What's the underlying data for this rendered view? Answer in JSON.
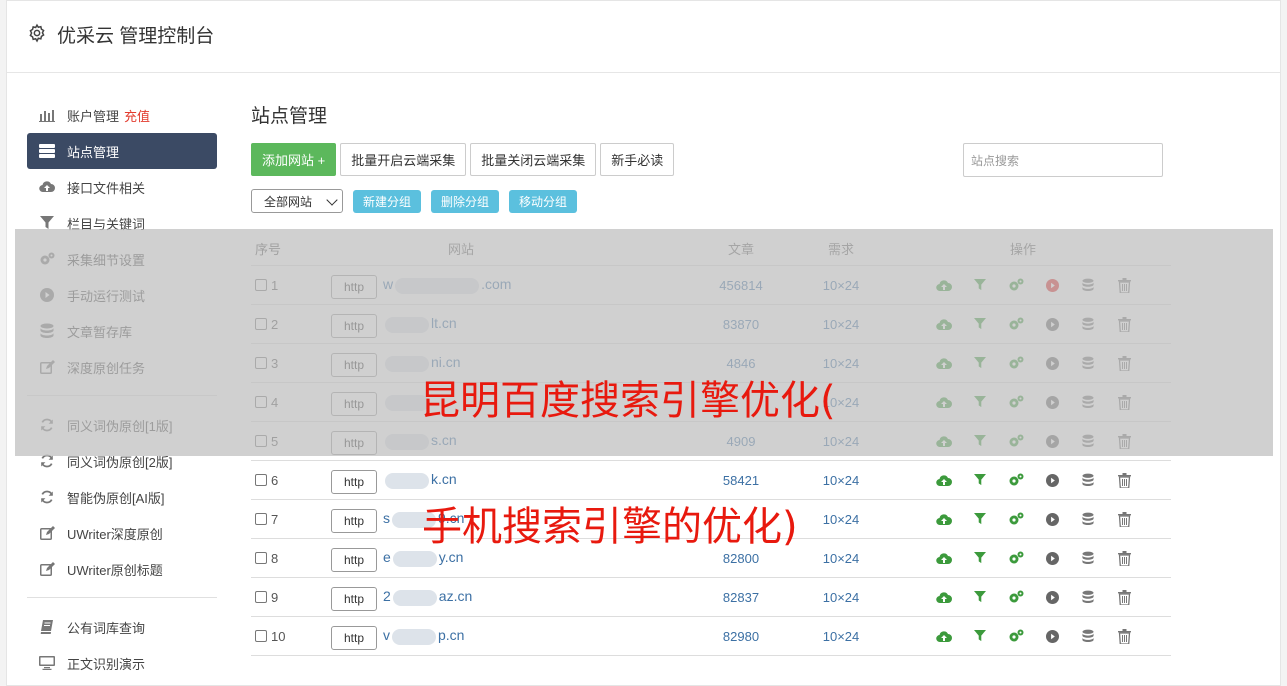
{
  "header": {
    "title": "优采云 管理控制台",
    "icon": "gear-icon"
  },
  "sidebar": {
    "group1": [
      {
        "label": "账户管理",
        "extra": "充值",
        "icon": "bar-chart-icon"
      },
      {
        "label": "站点管理",
        "icon": "server-icon",
        "active": true
      },
      {
        "label": "接口文件相关",
        "icon": "cloud-upload-icon"
      },
      {
        "label": "栏目与关键词",
        "icon": "filter-icon"
      },
      {
        "label": "采集细节设置",
        "icon": "cogs-icon"
      },
      {
        "label": "手动运行测试",
        "icon": "play-circle-icon"
      },
      {
        "label": "文章暂存库",
        "icon": "database-icon"
      },
      {
        "label": "深度原创任务",
        "icon": "edit-icon"
      }
    ],
    "group2": [
      {
        "label": "同义词伪原创[1版]",
        "icon": "refresh-icon"
      },
      {
        "label": "同义词伪原创[2版]",
        "icon": "refresh-icon"
      },
      {
        "label": "智能伪原创[AI版]",
        "icon": "refresh-icon"
      },
      {
        "label": "UWriter深度原创",
        "icon": "edit-icon"
      },
      {
        "label": "UWriter原创标题",
        "icon": "edit-icon"
      }
    ],
    "group3": [
      {
        "label": "公有词库查询",
        "icon": "book-icon"
      },
      {
        "label": "正文识别演示",
        "icon": "monitor-icon"
      }
    ]
  },
  "main": {
    "title": "站点管理",
    "buttons": {
      "add": "添加网站 +",
      "batch_on": "批量开启云端采集",
      "batch_off": "批量关闭云端采集",
      "guide": "新手必读"
    },
    "search_placeholder": "站点搜索",
    "group_select": "全部网站",
    "group_buttons": {
      "new": "新建分组",
      "delete": "删除分组",
      "move": "移动分组"
    },
    "table": {
      "headers": {
        "idx": "序号",
        "site": "网站",
        "articles": "文章",
        "demand": "需求",
        "ops": "操作"
      },
      "rows": [
        {
          "idx": "1",
          "protocol": "http",
          "pre": "w",
          "post": ".com",
          "articles": "456814",
          "demand": "10×24",
          "play_active": true
        },
        {
          "idx": "2",
          "protocol": "http",
          "pre": "",
          "post": "lt.cn",
          "articles": "83870",
          "demand": "10×24"
        },
        {
          "idx": "3",
          "protocol": "http",
          "pre": "",
          "post": "ni.cn",
          "articles": "4846",
          "demand": "10×24"
        },
        {
          "idx": "4",
          "protocol": "http",
          "pre": "",
          "post": "",
          "articles": "",
          "demand": "10×24"
        },
        {
          "idx": "5",
          "protocol": "http",
          "pre": "",
          "post": "s.cn",
          "articles": "4909",
          "demand": "10×24"
        },
        {
          "idx": "6",
          "protocol": "http",
          "pre": "",
          "post": "k.cn",
          "articles": "58421",
          "demand": "10×24"
        },
        {
          "idx": "7",
          "protocol": "http",
          "pre": "s",
          "post": "9.cn",
          "articles": "",
          "demand": "10×24"
        },
        {
          "idx": "8",
          "protocol": "http",
          "pre": "e",
          "post": "y.cn",
          "articles": "82800",
          "demand": "10×24"
        },
        {
          "idx": "9",
          "protocol": "http",
          "pre": "2",
          "post": "az.cn",
          "articles": "82837",
          "demand": "10×24"
        },
        {
          "idx": "10",
          "protocol": "http",
          "pre": "v",
          "post": "p.cn",
          "articles": "82980",
          "demand": "10×24"
        }
      ]
    }
  },
  "overlay": {
    "line1": "昆明百度搜索引擎优化(",
    "line2": "手机搜索引擎的优化)"
  },
  "colors": {
    "sidebar_active": "#3b4a64",
    "green": "#5cb85c",
    "info": "#5bc0de",
    "link": "#3c70a4",
    "overlay_text": "#e8190e"
  }
}
